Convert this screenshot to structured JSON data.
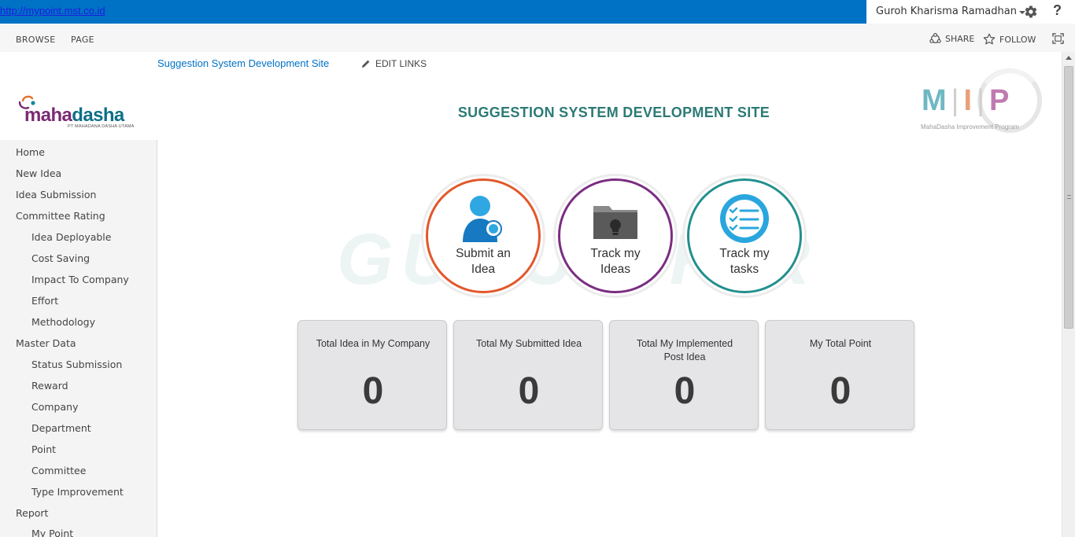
{
  "suite_bar": {
    "url": "http://mypoint.mst.co.id",
    "user_name": "Guroh Kharisma Ramadhan",
    "settings_icon": "gear-icon",
    "help_label": "?"
  },
  "ribbon": {
    "tabs": [
      "BROWSE",
      "PAGE"
    ],
    "share_label": "SHARE",
    "follow_label": "FOLLOW"
  },
  "header": {
    "site_link": "Suggestion System Development Site",
    "edit_links_label": "EDIT LINKS",
    "brand_logo": {
      "part1": "maha",
      "part2": "dasha",
      "subtitle": "PT MAHADANA DASHA UTAMA"
    },
    "mip_logo": {
      "letter1": "M",
      "sep1": "|",
      "letter2": "I",
      "sep2": "|",
      "letter3": "P",
      "subtitle": "MahaDasha Improvement Program",
      "colors": [
        "#6fb8c2",
        "#e8a07a",
        "#c07ab0"
      ]
    },
    "page_title": "SUGGESTION SYSTEM DEVELOPMENT SITE"
  },
  "nav": {
    "items": [
      {
        "label": "Home",
        "level": 0
      },
      {
        "label": "New Idea",
        "level": 0
      },
      {
        "label": "Idea Submission",
        "level": 0
      },
      {
        "label": "Committee Rating",
        "level": 0
      },
      {
        "label": "Idea Deployable",
        "level": 1
      },
      {
        "label": "Cost Saving",
        "level": 1
      },
      {
        "label": "Impact To Company",
        "level": 1
      },
      {
        "label": "Effort",
        "level": 1
      },
      {
        "label": "Methodology",
        "level": 1
      },
      {
        "label": "Master Data",
        "level": 0
      },
      {
        "label": "Status Submission",
        "level": 1
      },
      {
        "label": "Reward",
        "level": 1
      },
      {
        "label": "Company",
        "level": 1
      },
      {
        "label": "Department",
        "level": 1
      },
      {
        "label": "Point",
        "level": 1
      },
      {
        "label": "Committee",
        "level": 1
      },
      {
        "label": "Type Improvement",
        "level": 1
      },
      {
        "label": "Report",
        "level": 0
      },
      {
        "label": "My Point",
        "level": 1
      }
    ]
  },
  "watermark": "GURUH.K.R",
  "tiles": [
    {
      "label": "Submit an Idea",
      "ring_color": "#e2572a",
      "icon": "user-add-icon"
    },
    {
      "label": "Track my Ideas",
      "ring_color": "#7b2d82",
      "icon": "folder-bulb-icon"
    },
    {
      "label": "Track my tasks",
      "ring_color": "#22908e",
      "icon": "task-list-icon"
    }
  ],
  "stats": [
    {
      "label": "Total Idea in My Company",
      "value": "0"
    },
    {
      "label": "Total My Submitted Idea",
      "value": "0"
    },
    {
      "label": "Total My Implemented Post Idea",
      "value": "0"
    },
    {
      "label": "My Total Point",
      "value": "0"
    }
  ]
}
